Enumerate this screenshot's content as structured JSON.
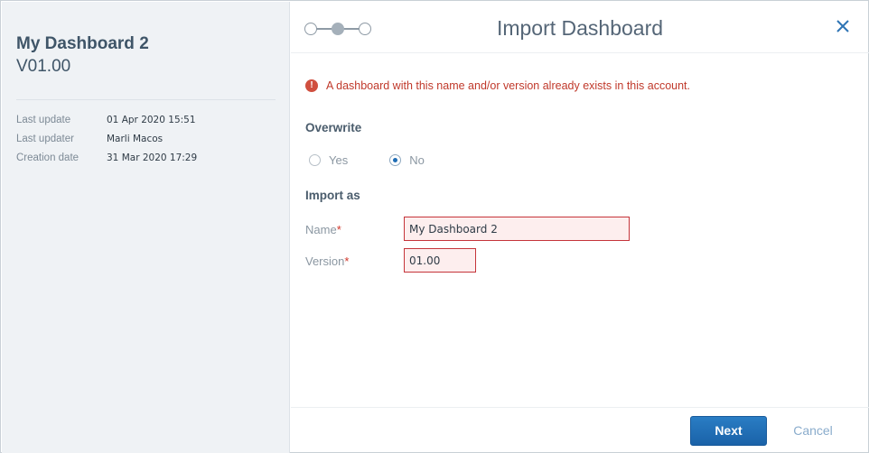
{
  "sidebar": {
    "title": "My Dashboard 2",
    "version": "V01.00",
    "meta": [
      {
        "key": "Last update",
        "value": "01 Apr 2020 15:51"
      },
      {
        "key": "Last updater",
        "value": "Marli Macos"
      },
      {
        "key": "Creation date",
        "value": "31 Mar 2020 17:29"
      }
    ]
  },
  "header": {
    "title": "Import Dashboard",
    "steps_total": 3,
    "current_step": 2
  },
  "error": {
    "message": "A dashboard with this name and/or version already exists in this account.",
    "icon_glyph": "!"
  },
  "overwrite": {
    "label": "Overwrite",
    "options": [
      {
        "label": "Yes",
        "checked": false
      },
      {
        "label": "No",
        "checked": true
      }
    ]
  },
  "import_as": {
    "label": "Import as",
    "name_label": "Name",
    "name_value": "My Dashboard 2",
    "version_label": "Version",
    "version_value": "01.00",
    "required_mark": "*"
  },
  "footer": {
    "next_label": "Next",
    "cancel_label": "Cancel"
  },
  "colors": {
    "accent": "#1f6db5",
    "error": "#c0392b",
    "sidebar_bg": "#eff2f5"
  },
  "icons": {
    "close": "close-icon",
    "error": "error-icon"
  }
}
